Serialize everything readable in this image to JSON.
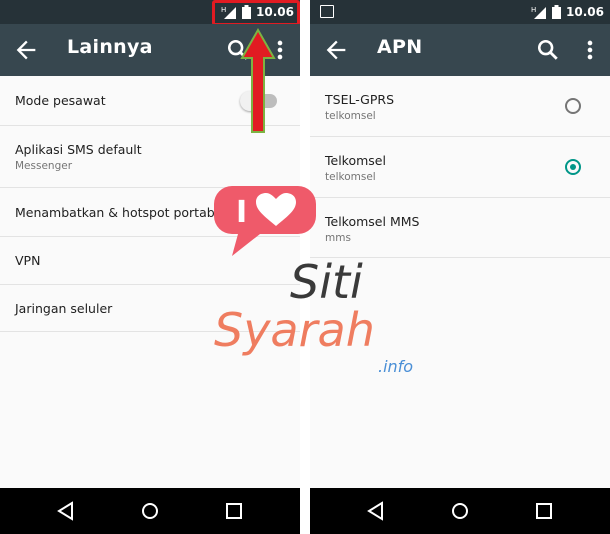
{
  "left": {
    "status": {
      "time": "10.06",
      "network": "H"
    },
    "toolbar": {
      "title": "Lainnya"
    },
    "items": [
      {
        "title": "Mode pesawat"
      },
      {
        "title": "Aplikasi SMS default",
        "subtitle": "Messenger"
      },
      {
        "title": "Menambatkan & hotspot portabel"
      },
      {
        "title": "VPN"
      },
      {
        "title": "Jaringan seluler"
      }
    ],
    "toggle_airplane": 0
  },
  "right": {
    "status": {
      "time": "10.06",
      "network": "H"
    },
    "toolbar": {
      "title": "APN"
    },
    "apns": [
      {
        "name": "TSEL-GPRS",
        "apn": "telkomsel",
        "selected": false
      },
      {
        "name": "Telkomsel",
        "apn": "telkomsel",
        "selected": true
      },
      {
        "name": "Telkomsel MMS",
        "apn": "mms",
        "selected": false
      }
    ]
  },
  "watermark": {
    "line1": "Siti",
    "line2": "Syarah",
    "line3": ".info",
    "heart_text": "I"
  },
  "colors": {
    "statusbar": "#263238",
    "toolbar": "#37474f",
    "accent": "#009688",
    "highlight": "#e11b22"
  }
}
